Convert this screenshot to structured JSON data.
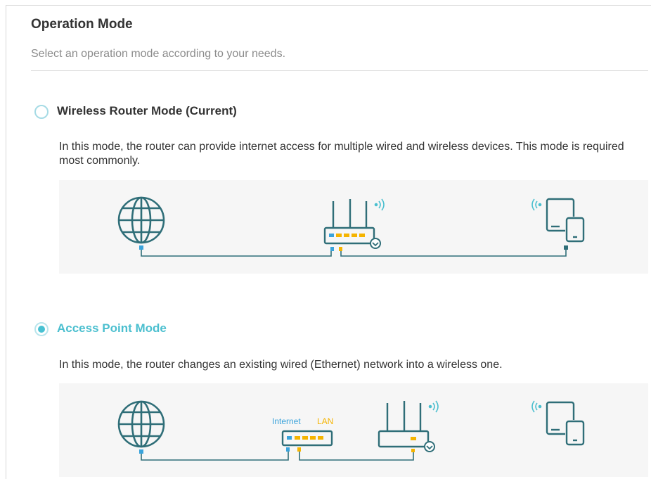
{
  "page": {
    "title": "Operation Mode",
    "subtitle": "Select an operation mode according to your needs."
  },
  "modes": [
    {
      "label": "Wireless Router Mode (Current)",
      "selected": false,
      "description": "In this mode, the router can provide internet access for multiple wired and wireless devices. This mode is required most commonly."
    },
    {
      "label": "Access Point Mode",
      "selected": true,
      "description": "In this mode, the router changes an existing wired (Ethernet) network into a wireless one."
    }
  ],
  "diagram_ap": {
    "internet_label": "Internet",
    "lan_label": "LAN"
  },
  "colors": {
    "accent": "#4bbfcf",
    "icon_stroke": "#2f6e78",
    "port_blue": "#3aa3db",
    "port_yellow": "#f5b400",
    "diagram_bg": "#f6f6f6"
  },
  "icons": [
    "globe-icon",
    "router-icon",
    "wifi-signal-icon",
    "tablet-phone-icon",
    "download-badge-icon"
  ]
}
